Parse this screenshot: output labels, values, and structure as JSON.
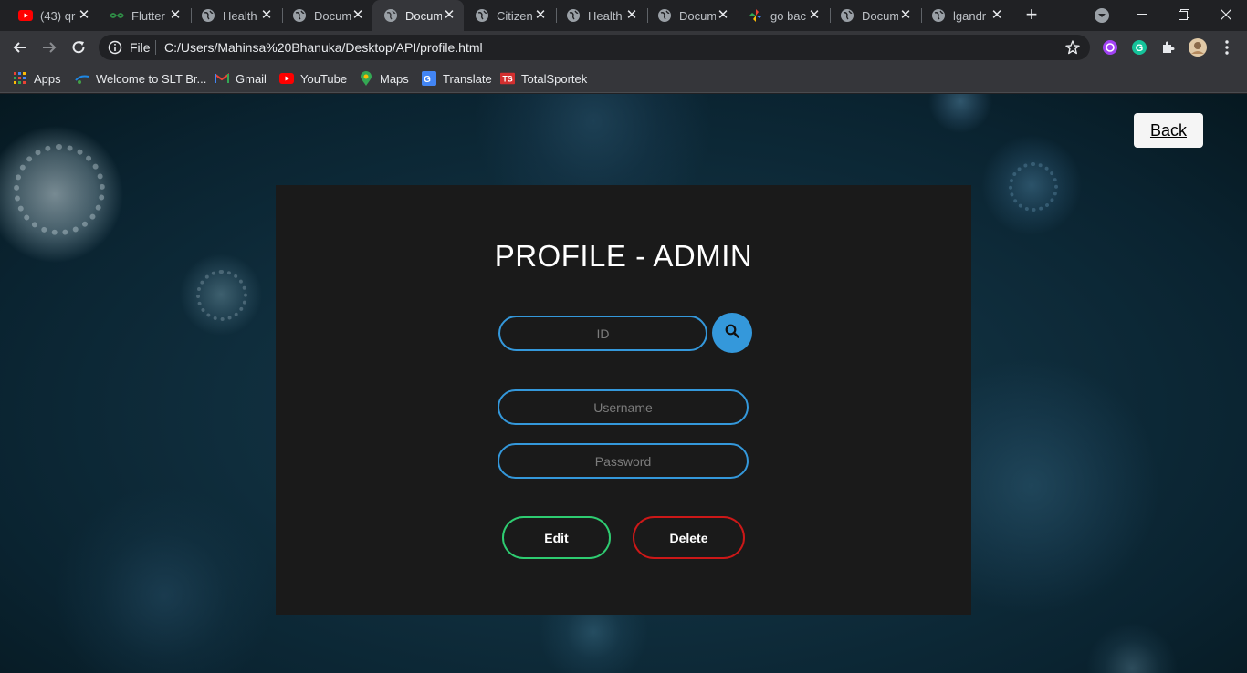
{
  "browser": {
    "tabs": [
      {
        "title": "(43) qr",
        "icon": "youtube-icon",
        "active": false
      },
      {
        "title": "Flutter",
        "icon": "geeksforgeeks-icon",
        "active": false
      },
      {
        "title": "Health",
        "icon": "globe-icon",
        "active": false
      },
      {
        "title": "Docum",
        "icon": "globe-icon",
        "active": false
      },
      {
        "title": "Docum",
        "icon": "globe-icon",
        "active": true
      },
      {
        "title": "Citizen",
        "icon": "globe-icon",
        "active": false
      },
      {
        "title": "Health",
        "icon": "globe-icon",
        "active": false
      },
      {
        "title": "Docum",
        "icon": "globe-icon",
        "active": false
      },
      {
        "title": "go bac",
        "icon": "pinwheel-icon",
        "active": false
      },
      {
        "title": "Docum",
        "icon": "globe-icon",
        "active": false
      },
      {
        "title": "lgandr",
        "icon": "globe-icon",
        "active": false
      }
    ],
    "address": {
      "scheme_label": "File",
      "url": "C:/Users/Mahinsa%20Bhanuka/Desktop/API/profile.html"
    },
    "bookmarks": [
      {
        "label": "Apps",
        "icon": "apps-grid-icon"
      },
      {
        "label": "Welcome to SLT Br...",
        "icon": "slt-icon"
      },
      {
        "label": "Gmail",
        "icon": "gmail-icon"
      },
      {
        "label": "YouTube",
        "icon": "youtube-icon"
      },
      {
        "label": "Maps",
        "icon": "maps-icon"
      },
      {
        "label": "Translate",
        "icon": "translate-icon"
      },
      {
        "label": "TotalSportek",
        "icon": "totalsportek-icon"
      }
    ]
  },
  "page": {
    "back_label": "Back",
    "title": "PROFILE - ADMIN",
    "id_placeholder": "ID",
    "username_placeholder": "Username",
    "password_placeholder": "Password",
    "edit_label": "Edit",
    "delete_label": "Delete"
  },
  "colors": {
    "accent_blue": "#3498db",
    "edit_green": "#2ecc71",
    "delete_red": "#cc1818",
    "card_bg": "#1a1a1a"
  }
}
